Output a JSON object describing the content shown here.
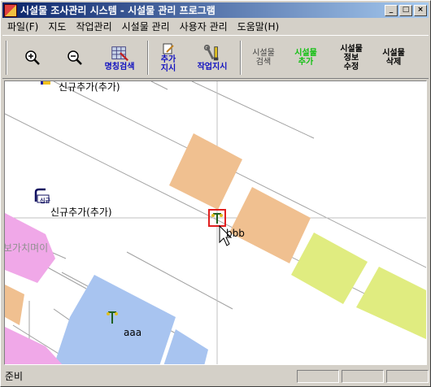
{
  "window": {
    "title": "시설물 조사관리 시스템 - 시설물 관리 프로그램",
    "minimize": "_",
    "maximize": "□",
    "close": "×"
  },
  "menu": {
    "items": [
      "파일(F)",
      "지도",
      "작업관리",
      "시설물 관리",
      "사용자 관리",
      "도움말(H)"
    ]
  },
  "toolbar": {
    "zoom_in_icon": "magnifier-plus-icon",
    "zoom_out_icon": "magnifier-minus-icon",
    "name_search": "명칭검색",
    "add_task_1": "추가",
    "add_task_2": "지시",
    "task_instruction": "작업지시",
    "facility_search_1": "시설물",
    "facility_search_2": "검색",
    "facility_add_1": "시설물",
    "facility_add_2": "추가",
    "facility_edit_1": "시설물",
    "facility_edit_2": "정보",
    "facility_edit_3": "수정",
    "facility_delete_1": "시설물",
    "facility_delete_2": "삭제"
  },
  "map": {
    "labels": {
      "new_add_top": "신규추가(추가)",
      "new_add_mid": "신규추가(추가)",
      "new_badge": "신규",
      "bbb": "bbb",
      "aaa": "aaa",
      "pink_label": "보가치며이"
    },
    "colors": {
      "building_orange": "#f0c090",
      "building_yellow": "#e0ec80",
      "building_blue": "#a8c4f0",
      "building_pink": "#f0a8e8",
      "road_line": "#a0a0a0",
      "selection_red": "#e02020"
    }
  },
  "status": {
    "text": "준비"
  }
}
